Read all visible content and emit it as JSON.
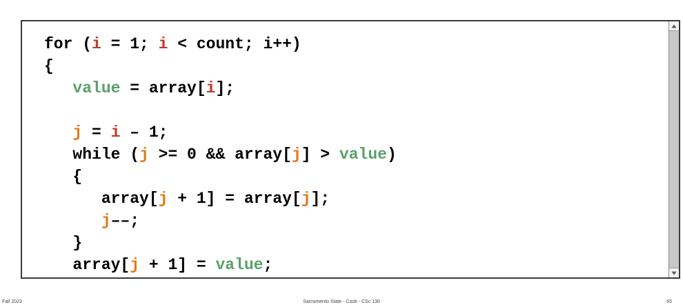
{
  "code": {
    "lines": [
      [
        {
          "t": "for (",
          "c": "plain"
        },
        {
          "t": "i",
          "c": "red"
        },
        {
          "t": " = 1; ",
          "c": "plain"
        },
        {
          "t": "i",
          "c": "red"
        },
        {
          "t": " < count; i++)",
          "c": "plain"
        }
      ],
      [
        {
          "t": "{",
          "c": "plain"
        }
      ],
      [
        {
          "t": "   ",
          "c": "plain"
        },
        {
          "t": "value",
          "c": "green"
        },
        {
          "t": " = array[",
          "c": "plain"
        },
        {
          "t": "i",
          "c": "red"
        },
        {
          "t": "];",
          "c": "plain"
        }
      ],
      [],
      [
        {
          "t": "   ",
          "c": "plain"
        },
        {
          "t": "j",
          "c": "orange"
        },
        {
          "t": " = ",
          "c": "plain"
        },
        {
          "t": "i",
          "c": "red"
        },
        {
          "t": " – 1;",
          "c": "plain"
        }
      ],
      [
        {
          "t": "   while (",
          "c": "plain"
        },
        {
          "t": "j",
          "c": "orange"
        },
        {
          "t": " >= 0 && array[",
          "c": "plain"
        },
        {
          "t": "j",
          "c": "orange"
        },
        {
          "t": "] > ",
          "c": "plain"
        },
        {
          "t": "value",
          "c": "green"
        },
        {
          "t": ")",
          "c": "plain"
        }
      ],
      [
        {
          "t": "   {",
          "c": "plain"
        }
      ],
      [
        {
          "t": "      array[",
          "c": "plain"
        },
        {
          "t": "j",
          "c": "orange"
        },
        {
          "t": " + 1] = array[",
          "c": "plain"
        },
        {
          "t": "j",
          "c": "orange"
        },
        {
          "t": "];",
          "c": "plain"
        }
      ],
      [
        {
          "t": "      ",
          "c": "plain"
        },
        {
          "t": "j",
          "c": "orange"
        },
        {
          "t": "––;",
          "c": "plain"
        }
      ],
      [
        {
          "t": "   }",
          "c": "plain"
        }
      ],
      [
        {
          "t": "   array[",
          "c": "plain"
        },
        {
          "t": "j",
          "c": "orange"
        },
        {
          "t": " + 1] = ",
          "c": "plain"
        },
        {
          "t": "value",
          "c": "green"
        },
        {
          "t": ";",
          "c": "plain"
        }
      ],
      [
        {
          "t": "}",
          "c": "plain"
        }
      ]
    ]
  },
  "colors": {
    "plain": "#000000",
    "red": "#c0392b",
    "orange": "#e07b1a",
    "green": "#5aa06a"
  },
  "scrollbar": {
    "up_icon": "triangle-up-icon",
    "down_icon": "triangle-down-icon"
  },
  "footer": {
    "left": "Fall 2023",
    "center": "Sacramento State - Cook - CSc 130",
    "right": "65"
  }
}
